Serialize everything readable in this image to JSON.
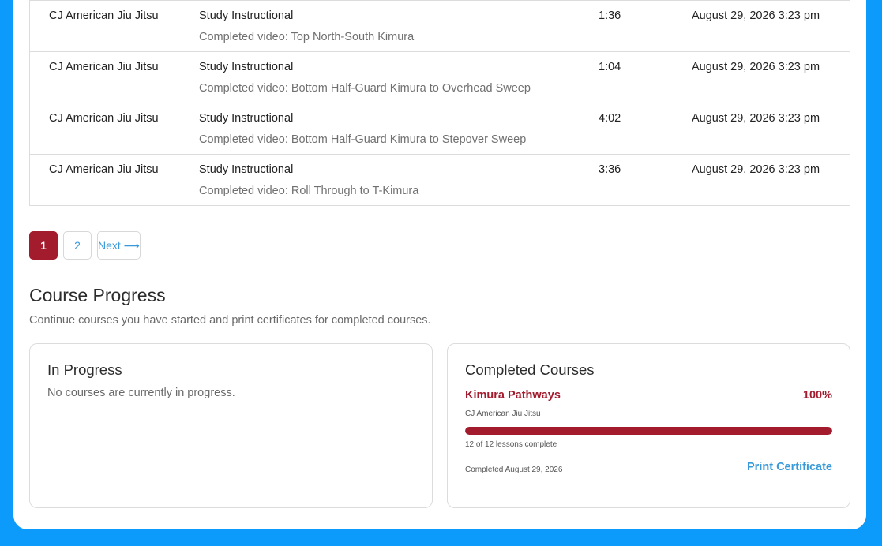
{
  "activity": {
    "rows": [
      {
        "user": "CJ American Jiu Jitsu",
        "type": "Study Instructional",
        "description": "Completed video: Top North-South Kimura",
        "duration": "1:36",
        "date": "August 29, 2026 3:23 pm"
      },
      {
        "user": "CJ American Jiu Jitsu",
        "type": "Study Instructional",
        "description": "Completed video: Bottom Half-Guard Kimura to Overhead Sweep",
        "duration": "1:04",
        "date": "August 29, 2026 3:23 pm"
      },
      {
        "user": "CJ American Jiu Jitsu",
        "type": "Study Instructional",
        "description": "Completed video: Bottom Half-Guard Kimura to Stepover Sweep",
        "duration": "4:02",
        "date": "August 29, 2026 3:23 pm"
      },
      {
        "user": "CJ American Jiu Jitsu",
        "type": "Study Instructional",
        "description": "Completed video: Roll Through to T-Kimura",
        "duration": "3:36",
        "date": "August 29, 2026 3:23 pm"
      }
    ]
  },
  "pagination": {
    "pages": [
      "1",
      "2"
    ],
    "current": "1",
    "next_label": "Next ⟶"
  },
  "course_progress": {
    "title": "Course Progress",
    "subtitle": "Continue courses you have started and print certificates for completed courses.",
    "in_progress": {
      "title": "In Progress",
      "empty_text": "No courses are currently in progress."
    },
    "completed": {
      "title": "Completed Courses",
      "course_name": "Kimura Pathways",
      "percent_label": "100%",
      "progress_fraction": 1.0,
      "organization": "CJ American Jiu Jitsu",
      "lessons_text": "12 of 12 lessons complete",
      "completed_text": "Completed August 29, 2026",
      "print_label": "Print Certificate"
    }
  },
  "colors": {
    "accent_red": "#a31c2e",
    "link_blue": "#3a9ad9",
    "background_blue": "#0d9bfb"
  }
}
